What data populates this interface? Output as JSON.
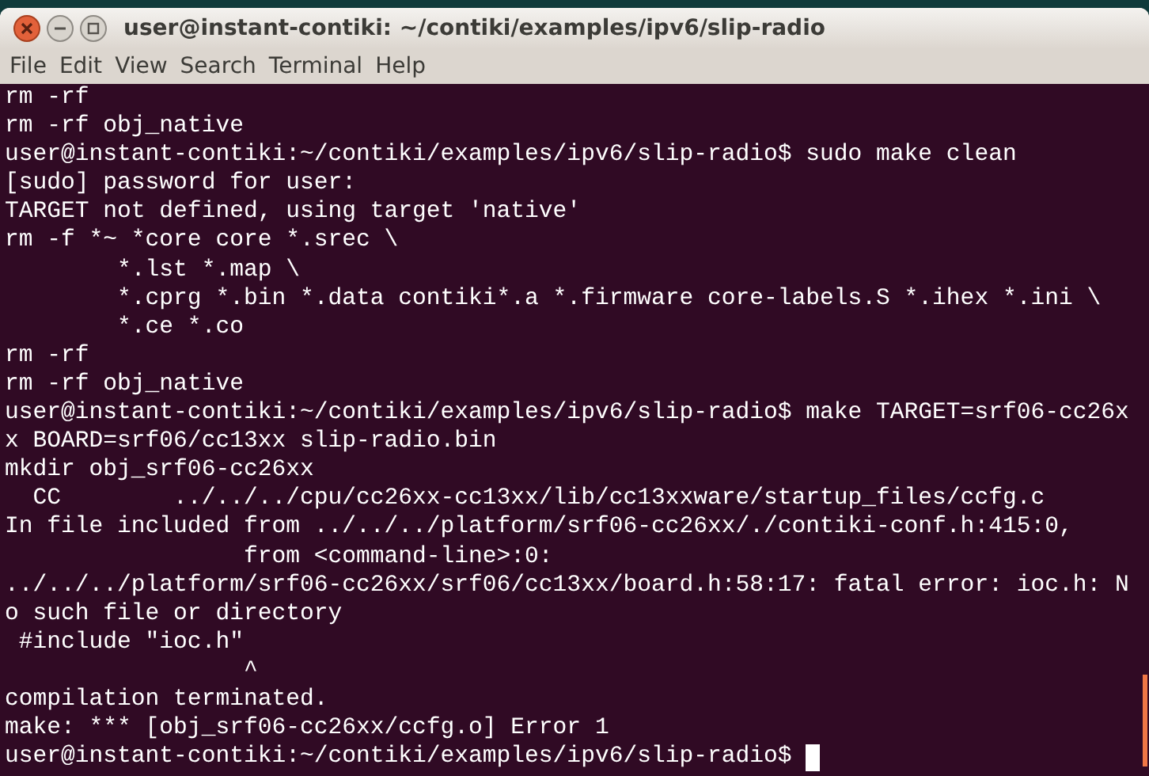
{
  "window": {
    "title": "user@instant-contiki: ~/contiki/examples/ipv6/slip-radio"
  },
  "menu": [
    "File",
    "Edit",
    "View",
    "Search",
    "Terminal",
    "Help"
  ],
  "terminal": {
    "cursor": true,
    "lines": [
      "rm -rf",
      "rm -rf obj_native",
      "user@instant-contiki:~/contiki/examples/ipv6/slip-radio$ sudo make clean",
      "[sudo] password for user:",
      "TARGET not defined, using target 'native'",
      "rm -f *~ *core core *.srec \\",
      "        *.lst *.map \\",
      "        *.cprg *.bin *.data contiki*.a *.firmware core-labels.S *.ihex *.ini \\",
      "        *.ce *.co",
      "rm -rf",
      "rm -rf obj_native",
      "user@instant-contiki:~/contiki/examples/ipv6/slip-radio$ make TARGET=srf06-cc26x",
      "x BOARD=srf06/cc13xx slip-radio.bin",
      "mkdir obj_srf06-cc26xx",
      "  CC        ../../../cpu/cc26xx-cc13xx/lib/cc13xxware/startup_files/ccfg.c",
      "In file included from ../../../platform/srf06-cc26xx/./contiki-conf.h:415:0,",
      "                 from <command-line>:0:",
      "../../../platform/srf06-cc26xx/srf06/cc13xx/board.h:58:17: fatal error: ioc.h: N",
      "o such file or directory",
      " #include \"ioc.h\"",
      "                 ^",
      "compilation terminated.",
      "make: *** [obj_srf06-cc26xx/ccfg.o] Error 1",
      "user@instant-contiki:~/contiki/examples/ipv6/slip-radio$ "
    ]
  }
}
